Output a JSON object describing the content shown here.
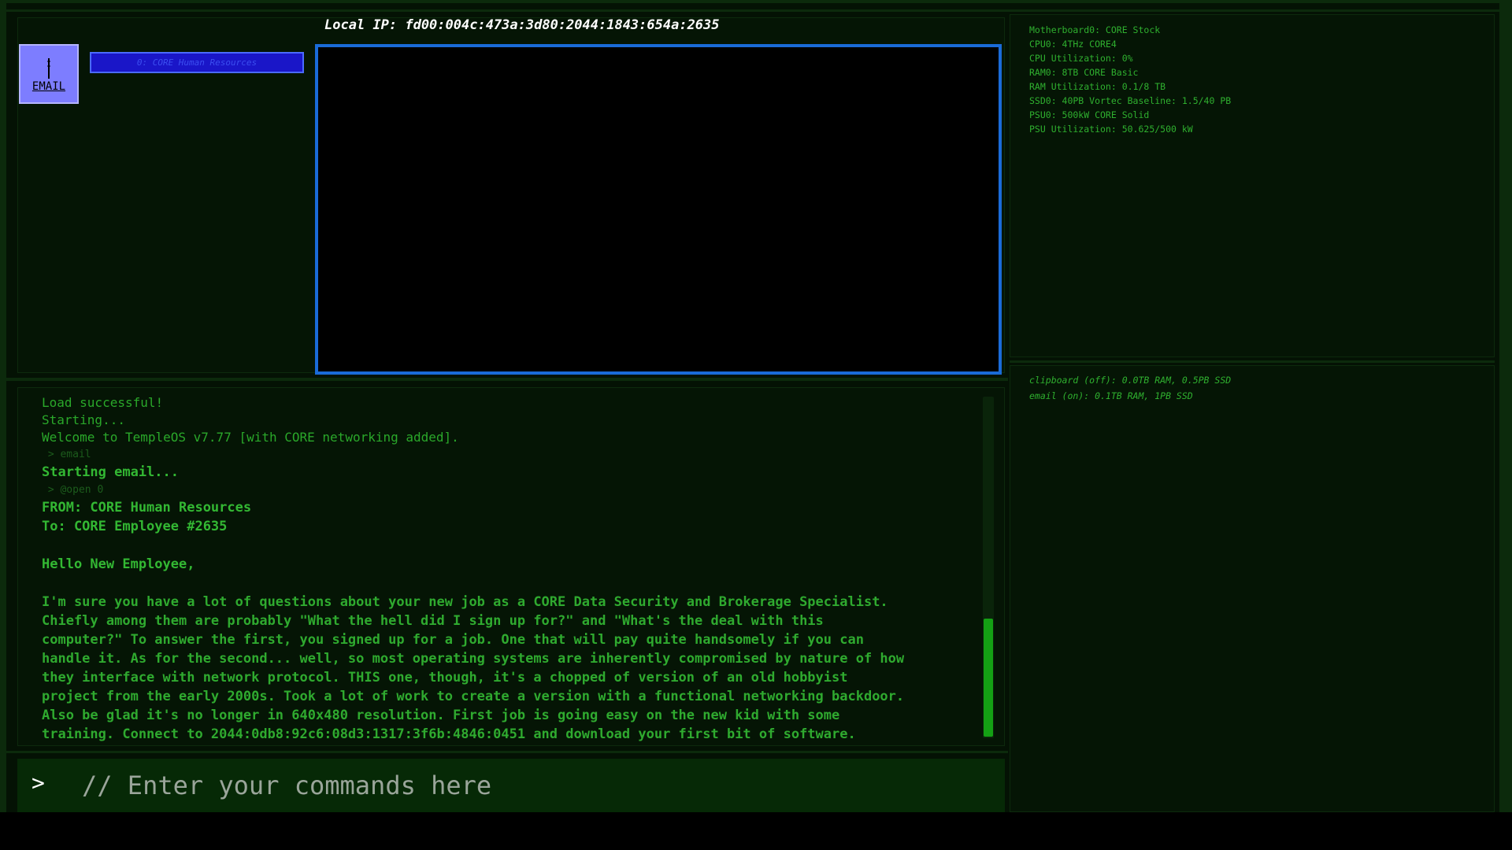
{
  "header": {
    "ip_label": "Local IP: fd00:004c:473a:3d80:2044:1843:654a:2635"
  },
  "apps": {
    "email_icon_label": "EMAIL"
  },
  "email_list": {
    "entries": [
      "0: CORE Human Resources"
    ]
  },
  "hardware": {
    "lines": [
      "Motherboard0: CORE Stock",
      "CPU0: 4THz CORE4",
      "CPU Utilization: 0%",
      "RAM0: 8TB CORE Basic",
      "RAM Utilization: 0.1/8 TB",
      "SSD0: 40PB Vortec Baseline: 1.5/40 PB",
      "PSU0: 500kW CORE Solid",
      "PSU Utilization: 50.625/500 kW"
    ]
  },
  "processes": {
    "lines": [
      "clipboard (off): 0.0TB RAM, 0.5PB SSD",
      "email (on): 0.1TB RAM, 1PB SSD"
    ]
  },
  "console": {
    "load": "Load successful!",
    "starting": "Starting...",
    "welcome": "Welcome to TempleOS v7.77 [with CORE networking added].",
    "cmd1": " > email",
    "starting_email": "Starting email...",
    "cmd2": " > @open 0",
    "from": "FROM: CORE Human Resources",
    "to": "To: CORE Employee #2635",
    "greeting": "Hello New Employee,",
    "body": "I'm sure you have a lot of questions about your new job as a CORE Data Security and Brokerage Specialist.\nChiefly among them are probably \"What the hell did I sign up for?\" and \"What's the deal with this\ncomputer?\" To answer the first, you signed up for a job. One that will pay quite handsomely if you can\nhandle it. As for the second... well, so most operating systems are inherently compromised by nature of how\nthey interface with network protocol. THIS one, though, it's a chopped of version of an old hobbyist\nproject from the early 2000s. Took a lot of work to create a version with a functional networking backdoor.\nAlso be glad it's no longer in 640x480 resolution. First job is going easy on the new kid with some\ntraining. Connect to 2044:0db8:92c6:08d3:1317:3f6b:4846:0451 and download your first bit of software."
  },
  "command_bar": {
    "prompt": ">",
    "placeholder": "// Enter your commands here"
  },
  "colors": {
    "background": "#041204",
    "terminal_green": "#2fb02f",
    "accent_blue": "#1a6bd8",
    "email_entry": "#1a16c8",
    "icon_bg": "#7d7dff"
  }
}
